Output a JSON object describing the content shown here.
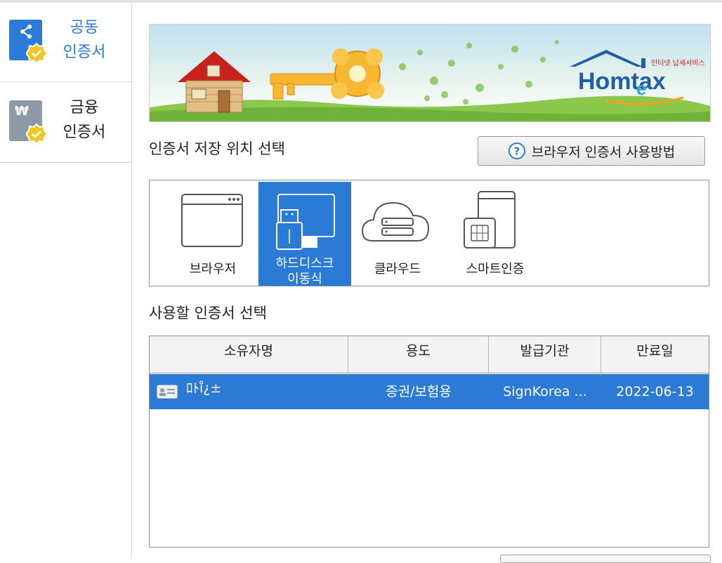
{
  "sidebar": {
    "items": [
      {
        "label_line1": "공동",
        "label_line2": "인증서",
        "icon": "share-icon",
        "active": true
      },
      {
        "label_line1": "금융",
        "label_line2": "인증서",
        "icon": "won-icon",
        "active": false
      }
    ]
  },
  "banner": {
    "logo_text": "Homtax",
    "logo_e": "e",
    "logo_tag": "인터넷 납세서비스"
  },
  "storage": {
    "title": "인증서 저장 위치 선택",
    "help_button": "브라우저 인증서 사용방법",
    "options": [
      {
        "label": "브라우저",
        "icon": "browser-icon"
      },
      {
        "label_line1": "하드디스크",
        "label_line2": "이동식",
        "icon": "usb-disk-icon",
        "selected": true
      },
      {
        "label": "클라우드",
        "icon": "cloud-icon"
      },
      {
        "label": "스마트인증",
        "icon": "smartphone-icon"
      }
    ]
  },
  "certs": {
    "title": "사용할 인증서 선택",
    "columns": [
      "소유자명",
      "용도",
      "발급기관",
      "만료일"
    ],
    "rows": [
      {
        "owner": "ﾛﾄi̊¿±",
        "usage": "증권/보험용",
        "issuer": "SignKorea ...",
        "expiry": "2022-06-13"
      }
    ]
  },
  "colors": {
    "accent": "#2a7ad6",
    "inactive_icon": "#8d9aa6",
    "badge": "#f4c51c"
  }
}
